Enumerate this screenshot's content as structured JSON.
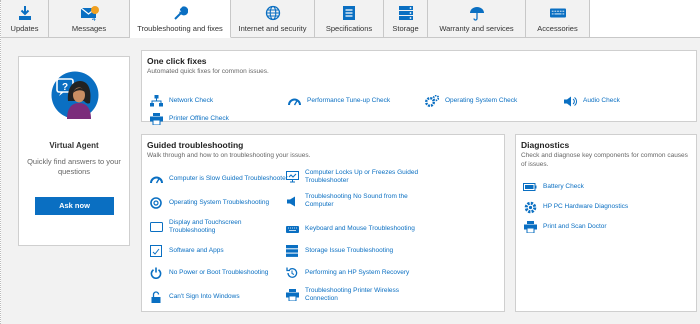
{
  "tabs": [
    {
      "label": "Updates",
      "icon": "download-icon"
    },
    {
      "label": "Messages",
      "icon": "envelope-icon",
      "badge": "",
      "count": "4"
    },
    {
      "label": "Troubleshooting and fixes",
      "icon": "wrench-icon"
    },
    {
      "label": "Internet and security",
      "icon": "globe-icon"
    },
    {
      "label": "Specifications",
      "icon": "spec-sheet-icon"
    },
    {
      "label": "Storage",
      "icon": "storage-icon"
    },
    {
      "label": "Warranty and services",
      "icon": "umbrella-icon"
    },
    {
      "label": "Accessories",
      "icon": "keyboard-icon"
    }
  ],
  "agent": {
    "title": "Virtual Agent",
    "text": "Quickly find answers to your questions",
    "button": "Ask now"
  },
  "one_click": {
    "title": "One click fixes",
    "subtitle": "Automated quick fixes for common issues.",
    "items": [
      {
        "label": "Network Check",
        "icon": "network-icon"
      },
      {
        "label": "Performance Tune-up Check",
        "icon": "speedometer-icon"
      },
      {
        "label": "Operating System Check",
        "icon": "gears-icon"
      },
      {
        "label": "Audio Check",
        "icon": "speaker-icon"
      },
      {
        "label": "Printer Offline Check",
        "icon": "printer-icon"
      }
    ]
  },
  "guided": {
    "title": "Guided troubleshooting",
    "subtitle": "Walk through and how to on troubleshooting your issues.",
    "items": [
      {
        "label": "Computer is Slow Guided Troubleshooter",
        "icon": "speedometer-icon"
      },
      {
        "label": "Computer Locks Up or Freezes Guided Troubleshooter",
        "icon": "monitor-icon"
      },
      {
        "label": "Operating System Troubleshooting",
        "icon": "disc-icon"
      },
      {
        "label": "Troubleshooting No Sound from the Computer",
        "icon": "speaker-icon"
      },
      {
        "label": "Display and Touchscreen Troubleshooting",
        "icon": "display-icon"
      },
      {
        "label": "Keyboard and Mouse Troubleshooting",
        "icon": "keyboard-icon"
      },
      {
        "label": "Software and Apps",
        "icon": "software-icon"
      },
      {
        "label": "Storage Issue Troubleshooting",
        "icon": "storage-icon"
      },
      {
        "label": "No Power or Boot Troubleshooting",
        "icon": "power-icon"
      },
      {
        "label": "Performing an HP System Recovery",
        "icon": "recovery-icon"
      },
      {
        "label": "Can't Sign Into Windows",
        "icon": "lock-icon"
      },
      {
        "label": "Troubleshooting Printer Wireless Connection",
        "icon": "printer-icon"
      }
    ]
  },
  "diagnostics": {
    "title": "Diagnostics",
    "subtitle": "Check and diagnose key components for common causes of issues.",
    "items": [
      {
        "label": "Battery Check",
        "icon": "battery-icon"
      },
      {
        "label": "HP PC Hardware Diagnostics",
        "icon": "gear-icon"
      },
      {
        "label": "Print and Scan Doctor",
        "icon": "printer-icon"
      }
    ]
  },
  "colors": {
    "accent": "#0a6fc2",
    "badge": "#f0a020",
    "background": "#f2f2f2"
  }
}
